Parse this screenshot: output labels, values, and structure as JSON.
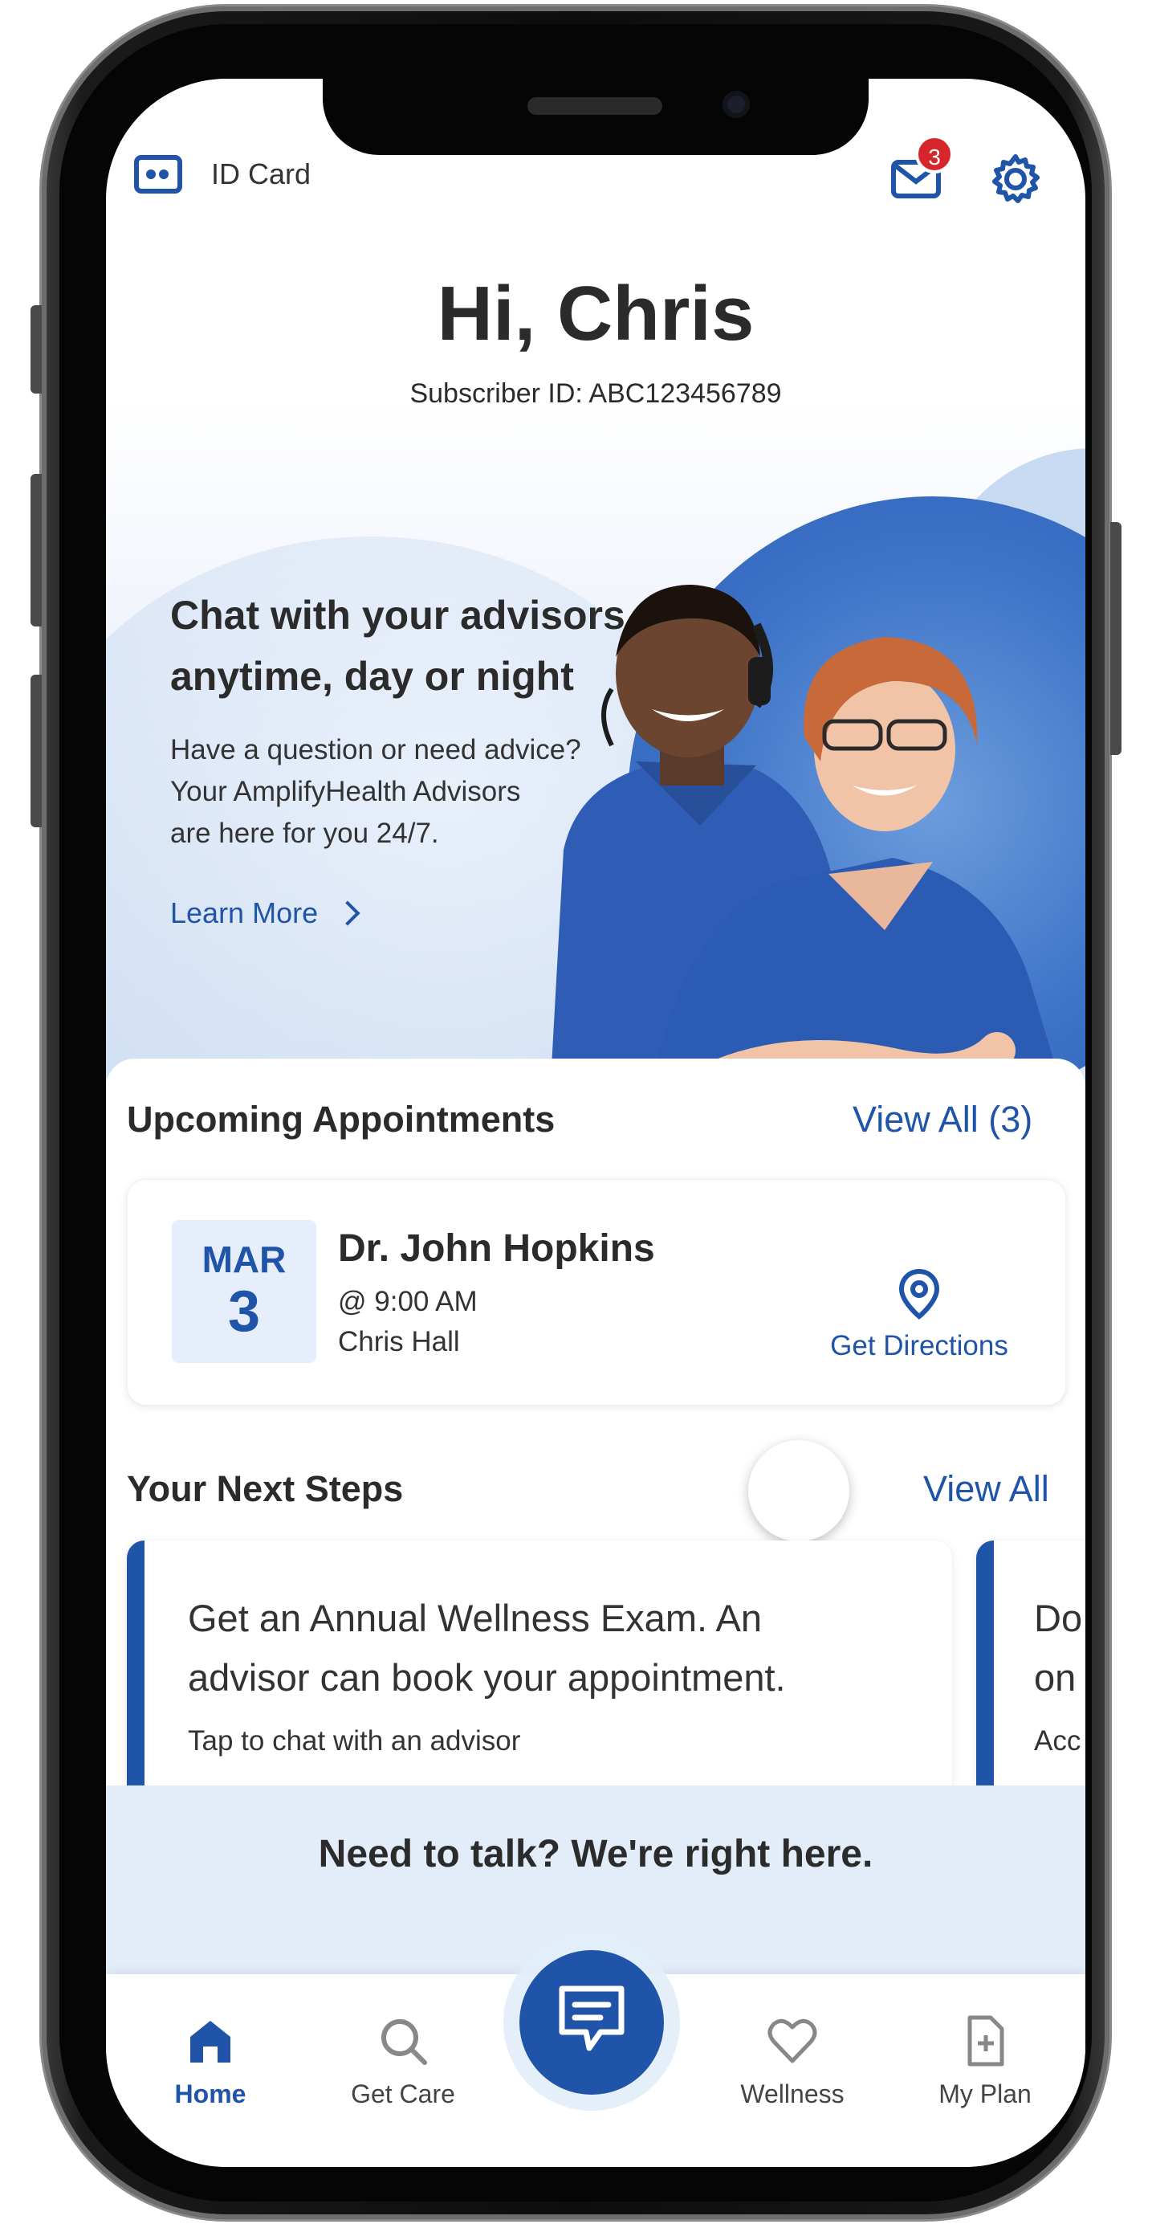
{
  "topbar": {
    "id_card_label": "ID Card",
    "mail_badge_count": "3",
    "icons": [
      "id-card-icon",
      "mail-icon",
      "gear-icon"
    ]
  },
  "greeting": {
    "title": "Hi, Chris",
    "subscriber": "Subscriber ID: ABC123456789"
  },
  "hero": {
    "title_line1": "Chat with your advisors",
    "title_line2": "anytime, day or night",
    "body_line1": "Have a question or need advice?",
    "body_line2": "Your AmplifyHealth Advisors",
    "body_line3": "are here for you 24/7.",
    "learn_more": "Learn More",
    "carousel_pages": 4,
    "carousel_active_index": 0
  },
  "appointments": {
    "title": "Upcoming Appointments",
    "view_all": "View All (3)",
    "item": {
      "month": "MAR",
      "day": "3",
      "doctor": "Dr. John Hopkins",
      "time": "@ 9:00 AM",
      "location": "Chris Hall",
      "directions": "Get Directions"
    }
  },
  "next_steps": {
    "title": "Your Next Steps",
    "view_all": "View All",
    "cards": [
      {
        "main_line1": "Get an Annual Wellness Exam. An",
        "main_line2": "advisor can book your appointment.",
        "sub": "Tap to chat with an advisor"
      },
      {
        "main_line1": "Do",
        "main_line2": "on",
        "sub": "Acc"
      }
    ]
  },
  "talk_banner": {
    "text": "Need to talk? We're right here."
  },
  "tabbar": {
    "home": "Home",
    "get_care": "Get Care",
    "wellness": "Wellness",
    "my_plan": "My Plan"
  },
  "colors": {
    "brand_blue": "#1f54a8",
    "badge_red": "#d7262b",
    "banner_bg": "#e2edf9"
  }
}
